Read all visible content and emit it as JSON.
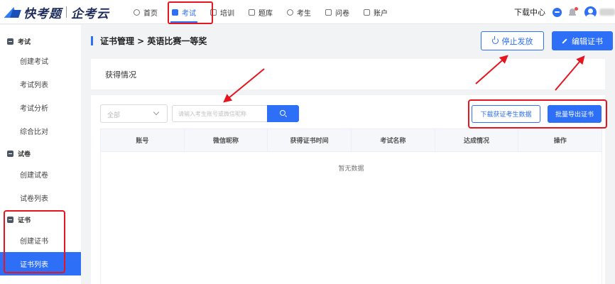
{
  "brand": {
    "name_primary": "快考题",
    "name_secondary": "企考云"
  },
  "topnav": {
    "items": [
      {
        "label": "首页",
        "icon": "home-icon"
      },
      {
        "label": "考试",
        "icon": "exam-icon",
        "active": true
      },
      {
        "label": "培训",
        "icon": "training-icon"
      },
      {
        "label": "题库",
        "icon": "question-bank-icon"
      },
      {
        "label": "考生",
        "icon": "examinee-icon"
      },
      {
        "label": "问卷",
        "icon": "survey-icon"
      },
      {
        "label": "账户",
        "icon": "account-icon"
      }
    ],
    "download_center": "下载中心"
  },
  "sidebar": {
    "groups": [
      {
        "title": "考试",
        "items": [
          "创建考试",
          "考试列表",
          "考试分析",
          "综合比对"
        ]
      },
      {
        "title": "试卷",
        "items": [
          "创建试卷",
          "试卷列表"
        ]
      },
      {
        "title": "证书",
        "items": [
          "创建证书",
          "证书列表"
        ]
      }
    ],
    "active_item": "证书列表"
  },
  "header": {
    "title": "证书管理 > 英语比赛一等奖",
    "stop_button": "停止发放",
    "edit_button": "编辑证书"
  },
  "section": {
    "label": "获得情况"
  },
  "filter": {
    "select_value": "全部",
    "search_placeholder": "请输入考生账号或微信昵称",
    "download_button": "下载获证考生数据",
    "export_button": "批量导出证书"
  },
  "table": {
    "columns": [
      "账号",
      "微信昵称",
      "获得证书时间",
      "考试名称",
      "达成情况",
      "操作"
    ],
    "empty_text": "暂无数据"
  },
  "colors": {
    "accent": "#2d6ff6",
    "annotation": "#e5161f"
  }
}
